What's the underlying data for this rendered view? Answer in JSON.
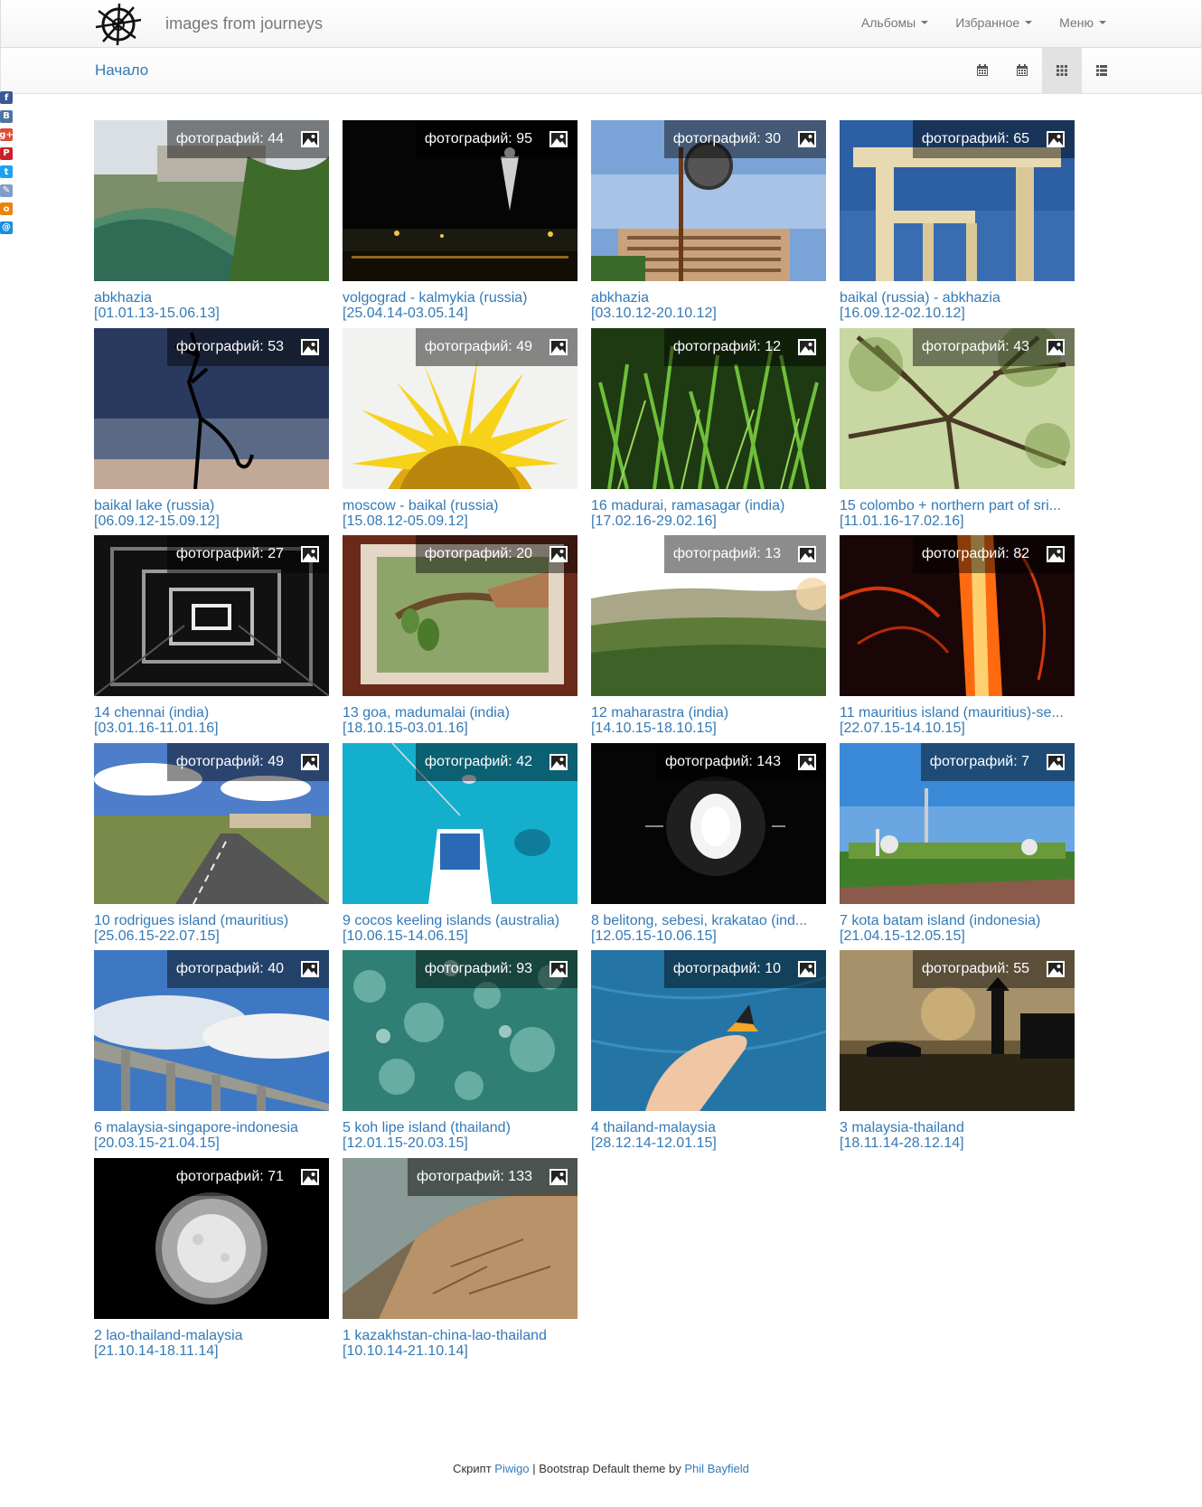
{
  "header": {
    "brand": "images from journeys",
    "menu": [
      {
        "label": "Альбомы"
      },
      {
        "label": "Избранное"
      },
      {
        "label": "Меню"
      }
    ]
  },
  "breadcrumb": {
    "home": "Начало"
  },
  "social": [
    {
      "icon": "facebook-icon",
      "glyph": "f",
      "color": "#3b5998"
    },
    {
      "icon": "vkontakte-icon",
      "glyph": "B",
      "color": "#4c75a3"
    },
    {
      "icon": "google-plus-icon",
      "glyph": "g+",
      "color": "#dd4b39"
    },
    {
      "icon": "pinterest-icon",
      "glyph": "P",
      "color": "#cb2027"
    },
    {
      "icon": "twitter-icon",
      "glyph": "t",
      "color": "#1da1f2"
    },
    {
      "icon": "livejournal-icon",
      "glyph": "✎",
      "color": "#7f9fc4"
    },
    {
      "icon": "odnoklassniki-icon",
      "glyph": "o",
      "color": "#ee8208"
    },
    {
      "icon": "mailru-icon",
      "glyph": "@",
      "color": "#168de2"
    }
  ],
  "badge_prefix": "фотографий: ",
  "albums": [
    {
      "count": "44",
      "title": "abkhazia",
      "dates": "[01.01.13-15.06.13]",
      "scene": "river"
    },
    {
      "count": "95",
      "title": "volgograd - kalmykia (russia)",
      "dates": "[25.04.14-03.05.14]",
      "scene": "night"
    },
    {
      "count": "30",
      "title": "abkhazia",
      "dates": "[03.10.12-20.10.12]",
      "scene": "building"
    },
    {
      "count": "65",
      "title": "baikal (russia) - abkhazia",
      "dates": "[16.09.12-02.10.12]",
      "scene": "arch"
    },
    {
      "count": "53",
      "title": "baikal lake (russia)",
      "dates": "[06.09.12-15.09.12]",
      "scene": "tree-dusk"
    },
    {
      "count": "49",
      "title": "moscow - baikal (russia)",
      "dates": "[15.08.12-05.09.12]",
      "scene": "sunflower"
    },
    {
      "count": "12",
      "title": "16 madurai, ramasagar (india)",
      "dates": "[17.02.16-29.02.16]",
      "scene": "grass"
    },
    {
      "count": "43",
      "title": "15 colombo + northern part of sri...",
      "dates": "[11.01.16-17.02.16]",
      "scene": "canopy"
    },
    {
      "count": "27",
      "title": "14 chennai (india)",
      "dates": "[03.01.16-11.01.16]",
      "scene": "tunnel"
    },
    {
      "count": "20",
      "title": "13 goa, madumalai (india)",
      "dates": "[18.10.15-03.01.16]",
      "scene": "frame"
    },
    {
      "count": "13",
      "title": "12 maharastra (india)",
      "dates": "[14.10.15-18.10.15]",
      "scene": "hills"
    },
    {
      "count": "82",
      "title": "11 mauritius island (mauritius)-se...",
      "dates": "[22.07.15-14.10.15]",
      "scene": "fire"
    },
    {
      "count": "49",
      "title": "10 rodrigues island (mauritius)",
      "dates": "[25.06.15-22.07.15]",
      "scene": "road"
    },
    {
      "count": "42",
      "title": "9 cocos keeling islands (australia)",
      "dates": "[10.06.15-14.06.15]",
      "scene": "boat"
    },
    {
      "count": "143",
      "title": "8 belitong, sebesi, krakatao (ind...",
      "dates": "[12.05.15-10.06.15]",
      "scene": "lamp"
    },
    {
      "count": "7",
      "title": "7 kota batam island (indonesia)",
      "dates": "[21.04.15-12.05.15]",
      "scene": "mosque"
    },
    {
      "count": "40",
      "title": "6 malaysia-singapore-indonesia",
      "dates": "[20.03.15-21.04.15]",
      "scene": "bridge"
    },
    {
      "count": "93",
      "title": "5 koh lipe island (thailand)",
      "dates": "[12.01.15-20.03.15]",
      "scene": "water"
    },
    {
      "count": "10",
      "title": "4 thailand-malaysia",
      "dates": "[28.12.14-12.01.15]",
      "scene": "butterfly"
    },
    {
      "count": "55",
      "title": "3 malaysia-thailand",
      "dates": "[18.11.14-28.12.14]",
      "scene": "lighthouse"
    },
    {
      "count": "71",
      "title": "2 lao-thailand-malaysia",
      "dates": "[21.10.14-18.11.14]",
      "scene": "moon"
    },
    {
      "count": "133",
      "title": "1 kazakhstan-china-lao-thailand",
      "dates": "[10.10.14-21.10.14]",
      "scene": "shore"
    }
  ],
  "footer": {
    "script_label": "Скрипт",
    "piwigo": "Piwigo",
    "separator": " | Bootstrap Default theme by ",
    "author": "Phil Bayfield"
  }
}
